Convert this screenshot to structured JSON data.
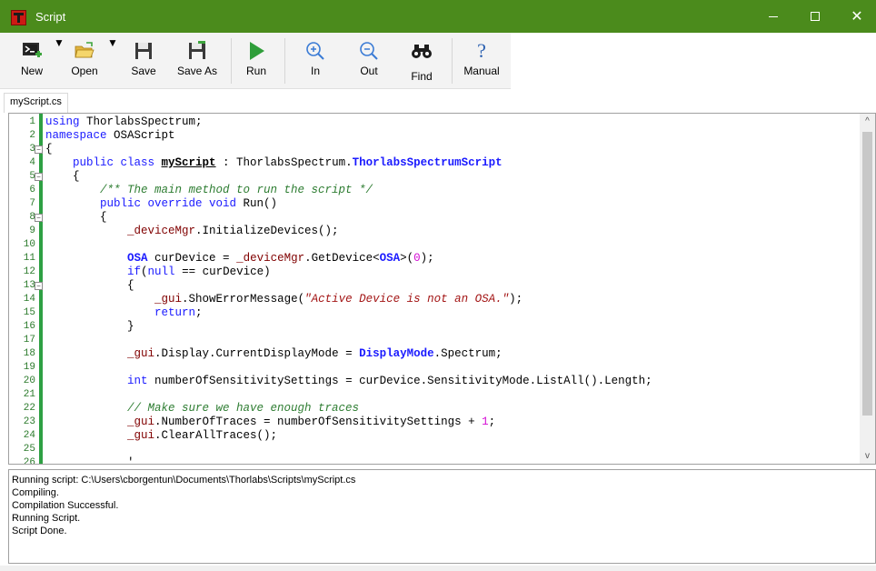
{
  "window": {
    "title": "Script",
    "controls": {
      "minimize": "—",
      "maximize": "☐",
      "close": "✕"
    }
  },
  "toolbar": {
    "new_label": "New",
    "open_label": "Open",
    "save_label": "Save",
    "save_as_label": "Save As",
    "run_label": "Run",
    "zoom_in_label": "In",
    "zoom_out_label": "Out",
    "find_label": "Find",
    "manual_label": "Manual",
    "manual_glyph": "?",
    "dropdown_glyph": "▼"
  },
  "tabs": [
    {
      "label": "myScript.cs"
    }
  ],
  "editor": {
    "line_numbers": [
      "1",
      "2",
      "3",
      "4",
      "5",
      "6",
      "7",
      "8",
      "9",
      "10",
      "11",
      "12",
      "13",
      "14",
      "15",
      "16",
      "17",
      "18",
      "19",
      "20",
      "21",
      "22",
      "23",
      "24",
      "25",
      "26"
    ],
    "fold_glyph": "−",
    "lines": [
      {
        "segments": [
          {
            "t": "using ",
            "c": "kw"
          },
          {
            "t": "ThorlabsSpectrum;",
            "c": ""
          }
        ]
      },
      {
        "segments": [
          {
            "t": "namespace ",
            "c": "kw"
          },
          {
            "t": "OSAScript",
            "c": ""
          }
        ]
      },
      {
        "segments": [
          {
            "t": "{",
            "c": ""
          }
        ]
      },
      {
        "segments": [
          {
            "t": "    public class ",
            "c": "kw"
          },
          {
            "t": "myScript",
            "c": "bold-ul"
          },
          {
            "t": " : ThorlabsSpectrum.",
            "c": ""
          },
          {
            "t": "ThorlabsSpectrumScript",
            "c": "cls"
          }
        ]
      },
      {
        "segments": [
          {
            "t": "    {",
            "c": ""
          }
        ]
      },
      {
        "segments": [
          {
            "t": "        /** The main method to run the script */",
            "c": "com"
          }
        ]
      },
      {
        "segments": [
          {
            "t": "        public override void ",
            "c": "kw"
          },
          {
            "t": "Run()",
            "c": ""
          }
        ]
      },
      {
        "segments": [
          {
            "t": "        {",
            "c": ""
          }
        ]
      },
      {
        "segments": [
          {
            "t": "            ",
            "c": ""
          },
          {
            "t": "_deviceMgr",
            "c": "id"
          },
          {
            "t": ".InitializeDevices();",
            "c": ""
          }
        ]
      },
      {
        "segments": [
          {
            "t": "",
            "c": ""
          }
        ]
      },
      {
        "segments": [
          {
            "t": "            ",
            "c": ""
          },
          {
            "t": "OSA",
            "c": "cls"
          },
          {
            "t": " curDevice = ",
            "c": ""
          },
          {
            "t": "_deviceMgr",
            "c": "id"
          },
          {
            "t": ".GetDevice<",
            "c": ""
          },
          {
            "t": "OSA",
            "c": "cls"
          },
          {
            "t": ">(",
            "c": ""
          },
          {
            "t": "0",
            "c": "num"
          },
          {
            "t": ");",
            "c": ""
          }
        ]
      },
      {
        "segments": [
          {
            "t": "            ",
            "c": ""
          },
          {
            "t": "if",
            "c": "kw"
          },
          {
            "t": "(",
            "c": ""
          },
          {
            "t": "null",
            "c": "kw"
          },
          {
            "t": " == curDevice)",
            "c": ""
          }
        ]
      },
      {
        "segments": [
          {
            "t": "            {",
            "c": ""
          }
        ]
      },
      {
        "segments": [
          {
            "t": "                ",
            "c": ""
          },
          {
            "t": "_gui",
            "c": "id"
          },
          {
            "t": ".ShowErrorMessage(",
            "c": ""
          },
          {
            "t": "\"Active Device is not an OSA.\"",
            "c": "str"
          },
          {
            "t": ");",
            "c": ""
          }
        ]
      },
      {
        "segments": [
          {
            "t": "                ",
            "c": ""
          },
          {
            "t": "return",
            "c": "kw"
          },
          {
            "t": ";",
            "c": ""
          }
        ]
      },
      {
        "segments": [
          {
            "t": "            }",
            "c": ""
          }
        ]
      },
      {
        "segments": [
          {
            "t": "",
            "c": ""
          }
        ]
      },
      {
        "segments": [
          {
            "t": "            ",
            "c": ""
          },
          {
            "t": "_gui",
            "c": "id"
          },
          {
            "t": ".Display.CurrentDisplayMode = ",
            "c": ""
          },
          {
            "t": "DisplayMode",
            "c": "cls"
          },
          {
            "t": ".Spectrum;",
            "c": ""
          }
        ]
      },
      {
        "segments": [
          {
            "t": "",
            "c": ""
          }
        ]
      },
      {
        "segments": [
          {
            "t": "            ",
            "c": ""
          },
          {
            "t": "int",
            "c": "kw"
          },
          {
            "t": " numberOfSensitivitySettings = curDevice.SensitivityMode.ListAll().Length;",
            "c": ""
          }
        ]
      },
      {
        "segments": [
          {
            "t": "",
            "c": ""
          }
        ]
      },
      {
        "segments": [
          {
            "t": "            // Make sure we have enough traces",
            "c": "com2"
          }
        ]
      },
      {
        "segments": [
          {
            "t": "            ",
            "c": ""
          },
          {
            "t": "_gui",
            "c": "id"
          },
          {
            "t": ".NumberOfTraces = numberOfSensitivitySettings + ",
            "c": ""
          },
          {
            "t": "1",
            "c": "num"
          },
          {
            "t": ";",
            "c": ""
          }
        ]
      },
      {
        "segments": [
          {
            "t": "            ",
            "c": ""
          },
          {
            "t": "_gui",
            "c": "id"
          },
          {
            "t": ".ClearAllTraces();",
            "c": ""
          }
        ]
      },
      {
        "segments": [
          {
            "t": "",
            "c": ""
          }
        ]
      },
      {
        "segments": [
          {
            "t": "            '",
            "c": ""
          }
        ]
      }
    ],
    "scroll_up": "^",
    "scroll_down": "v"
  },
  "output": {
    "lines": [
      "Running script: C:\\Users\\cborgentun\\Documents\\Thorlabs\\Scripts\\myScript.cs",
      "Compiling.",
      "Compilation Successful.",
      "Running Script.",
      "Script Done."
    ]
  },
  "colors": {
    "titlebar": "#4b8b1c",
    "keyword": "#1a1aff",
    "identifier": "#800000",
    "comment": "#2e7d32",
    "string": "#a31515",
    "number": "#d40ad4",
    "gutter_bar": "#2ea043"
  }
}
